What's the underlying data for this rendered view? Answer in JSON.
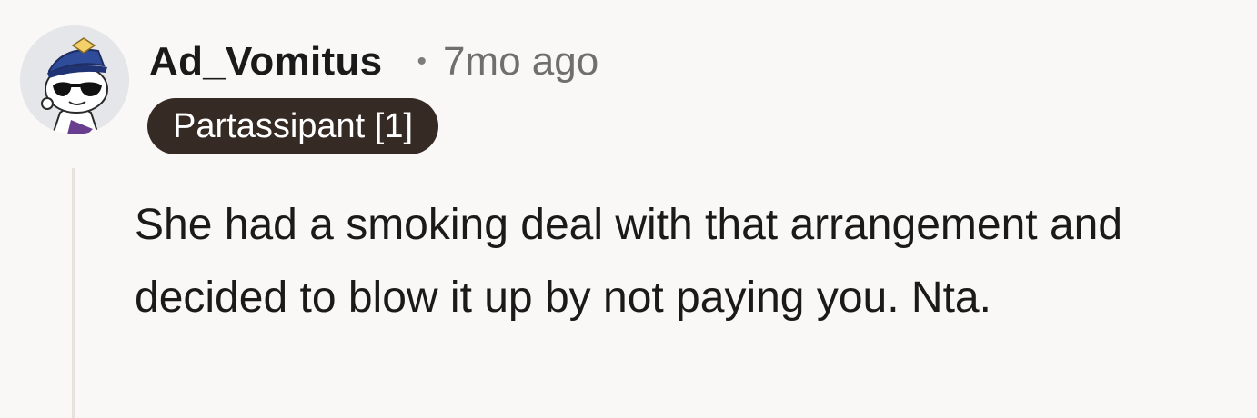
{
  "comment": {
    "author": "Ad_Vomitus",
    "separator": "•",
    "timestamp": "7mo ago",
    "flair": "Partassipant [1]",
    "body": "She had a smoking deal with that arrangement and decided to blow it up by not paying you. Nta.",
    "avatar": {
      "icon": "snoo-avatar-icon",
      "colors": {
        "background": "#E5E6EA",
        "hat": "#2F4C9A",
        "hat_badge": "#F3D06A",
        "sunglasses": "#111111",
        "face": "#FFFFFF"
      }
    }
  },
  "colors": {
    "page_background": "#FAF8F6",
    "text_primary": "#1A1A1B",
    "text_secondary": "#6F6F6F",
    "flair_background": "#352A24",
    "flair_text": "#FFFFFF",
    "thread_line": "#E8E2DD"
  }
}
